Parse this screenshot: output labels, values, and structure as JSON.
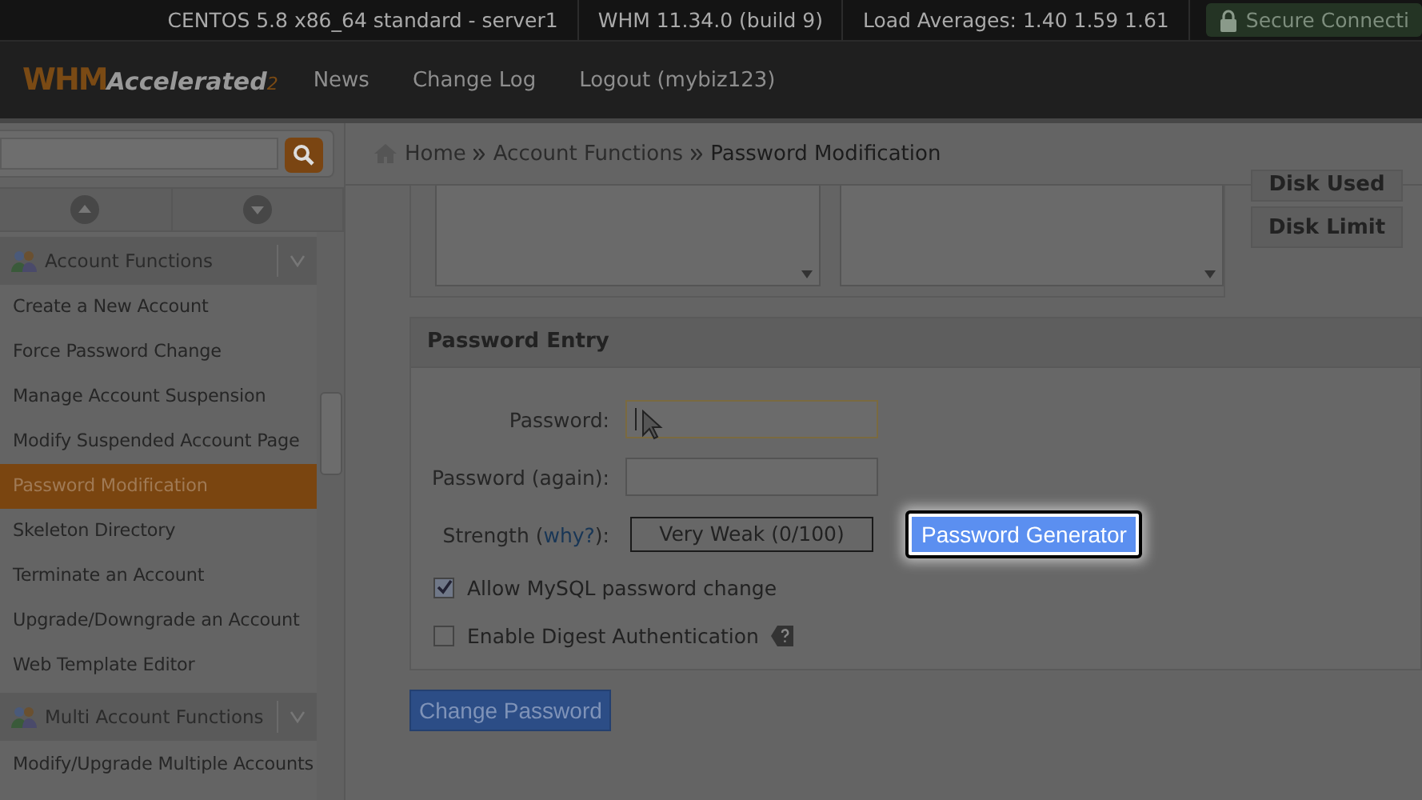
{
  "top_bar": {
    "items": [
      "CENTOS 5.8 x86_64 standard - server1",
      "WHM 11.34.0 (build 9)",
      "Load Averages: 1.40 1.59 1.61"
    ],
    "secure": "Secure Connecti"
  },
  "header": {
    "logo": {
      "main": "WHM",
      "accent": "Accelerated",
      "version": "2"
    },
    "nav": [
      "News",
      "Change Log",
      "Logout (mybiz123)"
    ]
  },
  "breadcrumb": [
    "Home",
    "Account Functions",
    "Password Modification"
  ],
  "sidebar": {
    "sections": [
      {
        "title": "Account Functions",
        "expanded": true,
        "items": [
          {
            "label": "Create a New Account",
            "selected": false
          },
          {
            "label": "Force Password Change",
            "selected": false
          },
          {
            "label": "Manage Account Suspension",
            "selected": false
          },
          {
            "label": "Modify Suspended Account Page",
            "selected": false
          },
          {
            "label": "Password Modification",
            "selected": true
          },
          {
            "label": "Skeleton Directory",
            "selected": false
          },
          {
            "label": "Terminate an Account",
            "selected": false
          },
          {
            "label": "Upgrade/Downgrade an Account",
            "selected": false
          },
          {
            "label": "Web Template Editor",
            "selected": false
          }
        ]
      },
      {
        "title": "Multi Account Functions",
        "expanded": true,
        "items": [
          {
            "label": "Modify/Upgrade Multiple Accounts",
            "selected": false
          }
        ]
      }
    ]
  },
  "sort_buttons": [
    "Disk Used",
    "Disk Limit"
  ],
  "password_entry": {
    "title": "Password Entry",
    "password_label": "Password:",
    "again_label": "Password (again):",
    "strength_label": "Strength (",
    "why_link": "why?",
    "strength_suffix": "):",
    "strength_value": "Very Weak (0/100)",
    "generator_button": "Password Generator",
    "options": [
      {
        "label": "Allow MySQL password change",
        "checked": true,
        "help": false
      },
      {
        "label": "Enable Digest Authentication",
        "checked": false,
        "help": true
      }
    ]
  },
  "submit_button": "Change Password"
}
